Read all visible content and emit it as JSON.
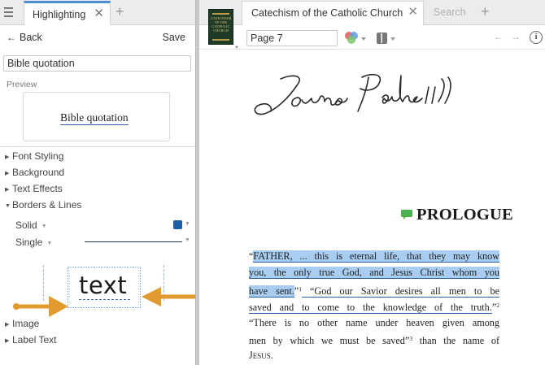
{
  "left_panel": {
    "tab_title": "Highlighting",
    "tab_close": "✕",
    "add_tab": "+",
    "back_label": "Back",
    "back_arrow": "←",
    "save_label": "Save",
    "style_name_value": "Bible quotation",
    "preview_label": "Preview",
    "preview_text": "Bible quotation",
    "sections": {
      "font_styling": "Font Styling",
      "background": "Background",
      "text_effects": "Text Effects",
      "borders_lines": "Borders & Lines",
      "image": "Image",
      "label_text": "Label Text"
    },
    "borders": {
      "style_value": "Solid",
      "line_value": "Single",
      "color": "#1a5ea8"
    },
    "illustration_word": "text",
    "arrow_color": "#e19a2e"
  },
  "right_panel": {
    "book_cover_title": "CATECHISM OF THE CATHOLIC CHURCH",
    "tab_title": "Catechism of the Catholic Church",
    "tab_close": "✕",
    "search_tab": "Search",
    "add_tab": "+",
    "page_value": "Page 7",
    "nav_back": "←",
    "nav_forward": "→",
    "info": "i",
    "heading": "PROLOGUE",
    "body": {
      "line1_q": "“",
      "line1_hl": "FATHER, ... this is eternal life, that they may know",
      "line2_hl": "you, the only true God, and Jesus Christ whom you",
      "line3_hl": "have sent.",
      "line3_q": "”",
      "line3_sup": "1",
      "line3_ul": " “God our Savior desires all men to be",
      "line4_ul": "saved and to come to the knowledge of the truth.",
      "line4_q": "”",
      "line4_sup": "2",
      "line5": "“There is no other name under heaven given among",
      "line6_a": "men by which we must be saved”",
      "line6_sup": "3",
      "line6_b": " than the name of",
      "line7": "Jesus."
    },
    "highlight_color": "#a9cdf0",
    "underline_color": "#2b5fa7"
  }
}
